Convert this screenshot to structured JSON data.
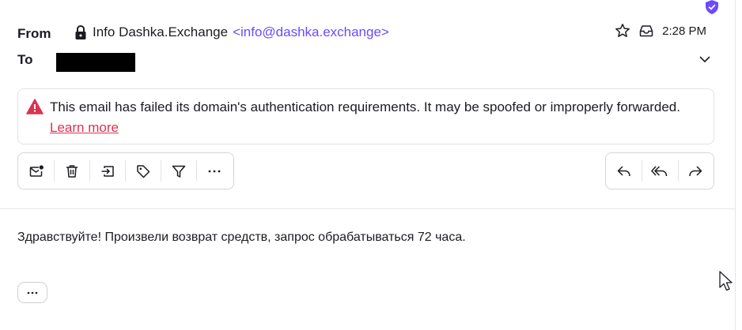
{
  "header": {
    "from_label": "From",
    "to_label": "To",
    "sender_name": "Info Dashka.Exchange",
    "sender_address": "<info@dashka.exchange>",
    "time": "2:28 PM"
  },
  "alert": {
    "message": "This email has failed its domain's authentication requirements. It may be spoofed or improperly forwarded.",
    "link": "Learn more",
    "color": "#dc3251"
  },
  "toolbar": {
    "actions": [
      "mark-unread-icon",
      "trash-icon",
      "move-icon",
      "label-icon",
      "filter-icon",
      "more-icon"
    ]
  },
  "reply_actions": [
    "reply-icon",
    "reply-all-icon",
    "forward-icon"
  ],
  "body": {
    "text": "Здравствуйте! Произвели возврат средств, запрос обрабатываться 72 часа.",
    "expand_label": "···"
  },
  "colors": {
    "accent": "#6d4aff",
    "text": "#1c1b22",
    "border": "#d6d6dc"
  }
}
